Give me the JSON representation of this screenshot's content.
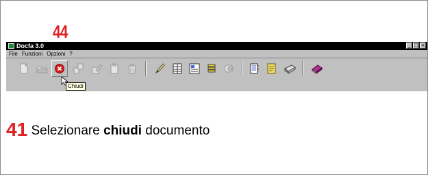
{
  "annotation": {
    "step_number": "44"
  },
  "window": {
    "title": "Docfa 3.0",
    "controls": [
      "_",
      "□",
      "×"
    ]
  },
  "menu": {
    "items": [
      "File",
      "Funzioni",
      "Opzioni",
      "?"
    ]
  },
  "toolbar": {
    "tooltip": "Chiudi",
    "icons": [
      "new-document-icon",
      "open-folder-icon",
      "close-document-icon",
      "copy-icon",
      "edit-icon",
      "clipboard-icon",
      "recycle-icon",
      "pencil-icon",
      "grid-icon",
      "form-icon",
      "stack-icon",
      "toggle-icon",
      "list-icon",
      "note-icon",
      "print-icon",
      "book-icon"
    ]
  },
  "instruction": {
    "number": "41",
    "prefix": "Selezionare",
    "keyword": "chiudi",
    "suffix": "documento"
  },
  "colors": {
    "annotation_red": "#e02020",
    "titlebar": "#000000",
    "toolbar_bg": "#c0c0c0",
    "close_icon_red": "#d41c1c"
  }
}
